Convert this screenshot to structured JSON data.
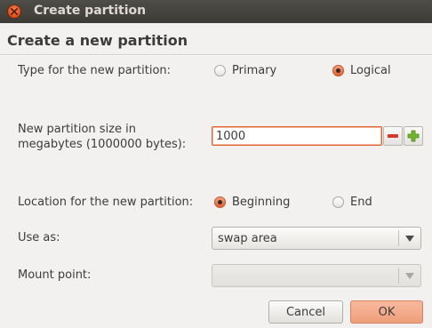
{
  "window": {
    "title": "Create partition"
  },
  "dialog": {
    "heading": "Create a new partition",
    "type_label": "Type for the new partition:",
    "type_options": [
      {
        "label": "Primary",
        "selected": false
      },
      {
        "label": "Logical",
        "selected": true
      }
    ],
    "size_label_line1": "New partition size in",
    "size_label_line2": "megabytes (1000000 bytes):",
    "size_value": "1000",
    "location_label": "Location for the new partition:",
    "location_options": [
      {
        "label": "Beginning",
        "selected": true
      },
      {
        "label": "End",
        "selected": false
      }
    ],
    "use_as_label": "Use as:",
    "use_as_value": "swap area",
    "mount_point_label": "Mount point:",
    "mount_point_value": "",
    "cancel_label": "Cancel",
    "ok_label": "OK"
  },
  "colors": {
    "accent": "#e0612f",
    "titlebar": "#3c3b37",
    "dialog_bg": "#f2f1f0",
    "ok_button": "#f4ab8b"
  }
}
